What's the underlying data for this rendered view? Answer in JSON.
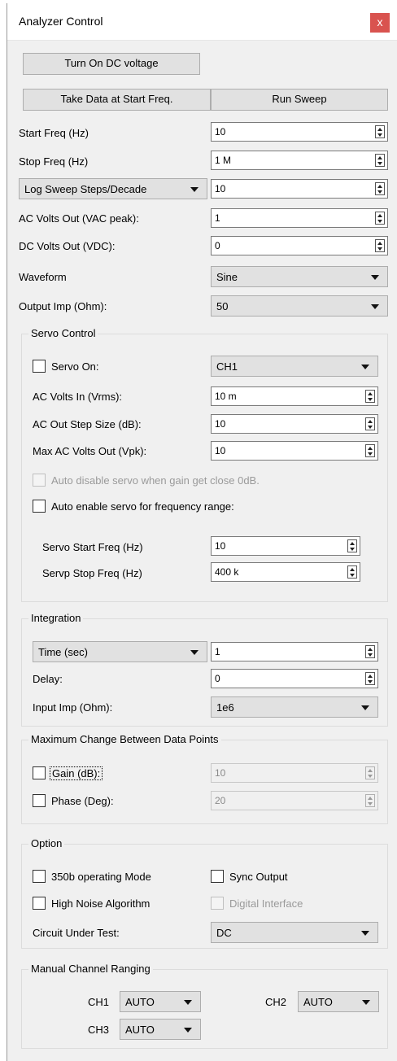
{
  "window": {
    "title": "Analyzer Control",
    "close_glyph": "x"
  },
  "buttons": {
    "dc_voltage": "Turn On DC voltage",
    "take_data": "Take Data at Start Freq.",
    "run_sweep": "Run Sweep"
  },
  "fields": {
    "start_freq": {
      "label": "Start Freq (Hz)",
      "value": "10"
    },
    "stop_freq": {
      "label": "Stop Freq (Hz)",
      "value": "1 M"
    },
    "sweep_steps": {
      "selected": "Log Sweep Steps/Decade",
      "value": "10"
    },
    "ac_volts_out": {
      "label": "AC Volts Out (VAC peak):",
      "value": "1"
    },
    "dc_volts_out": {
      "label": "DC Volts Out (VDC):",
      "value": "0"
    },
    "waveform": {
      "label": "Waveform",
      "selected": "Sine"
    },
    "output_imp": {
      "label": "Output Imp (Ohm):",
      "selected": "50"
    }
  },
  "servo": {
    "title": "Servo Control",
    "servo_on": {
      "label": "Servo On:",
      "channel": "CH1"
    },
    "ac_volts_in": {
      "label": "AC Volts In (Vrms):",
      "value": "10 m"
    },
    "ac_out_step": {
      "label": "AC Out Step Size (dB):",
      "value": "10"
    },
    "max_ac_out": {
      "label": "Max AC Volts Out (Vpk):",
      "value": "10"
    },
    "auto_disable": "Auto disable servo when gain get close 0dB.",
    "auto_enable": "Auto enable servo for frequency range:",
    "start_freq": {
      "label": "Servo Start Freq (Hz)",
      "value": "10"
    },
    "stop_freq": {
      "label": "Servp Stop Freq (Hz)",
      "value": "400 k"
    }
  },
  "integration": {
    "title": "Integration",
    "mode": "Time (sec)",
    "mode_value": "1",
    "delay": {
      "label": "Delay:",
      "value": "0"
    },
    "input_imp": {
      "label": "Input Imp (Ohm):",
      "selected": "1e6"
    }
  },
  "max_change": {
    "title": "Maximum Change Between Data Points",
    "gain": {
      "label": "Gain (dB):",
      "value": "10"
    },
    "phase": {
      "label": "Phase (Deg):",
      "value": "20"
    }
  },
  "option": {
    "title": "Option",
    "mode_350b": "350b operating Mode",
    "sync_output": "Sync Output",
    "high_noise": "High Noise Algorithm",
    "digital_interface": "Digital Interface",
    "circuit_under_test": {
      "label": "Circuit Under Test:",
      "selected": "DC"
    }
  },
  "ranging": {
    "title": "Manual Channel Ranging",
    "ch1": {
      "label": "CH1",
      "selected": "AUTO"
    },
    "ch2": {
      "label": "CH2",
      "selected": "AUTO"
    },
    "ch3": {
      "label": "CH3",
      "selected": "AUTO"
    }
  }
}
